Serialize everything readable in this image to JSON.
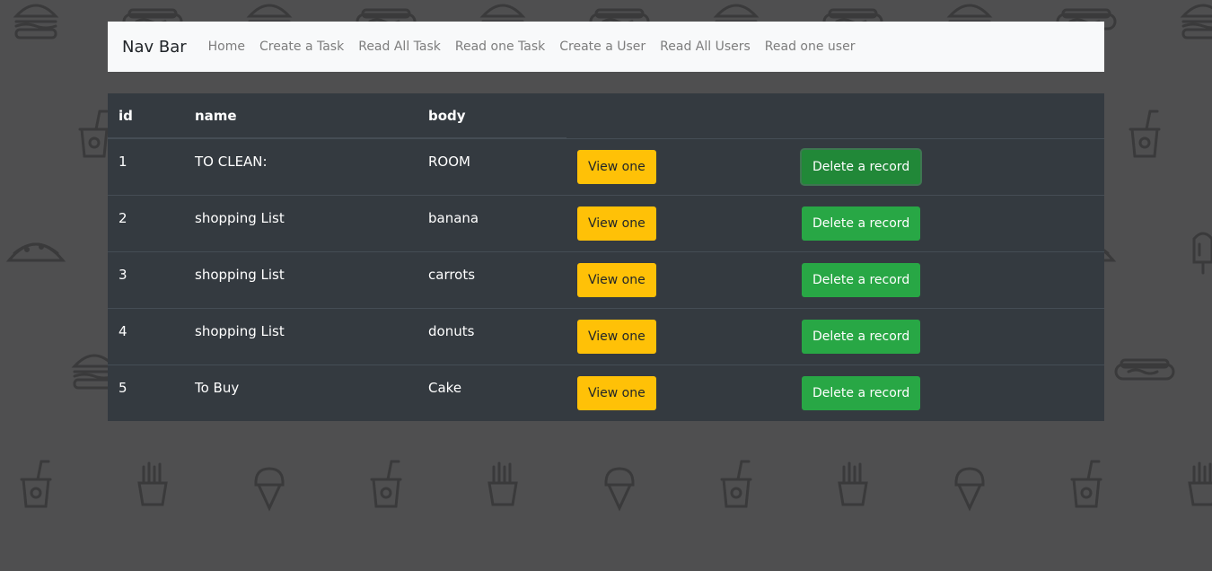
{
  "navbar": {
    "brand": "Nav Bar",
    "links": [
      "Home",
      "Create a Task",
      "Read All Task",
      "Read one Task",
      "Create a User",
      "Read All Users",
      "Read one user"
    ]
  },
  "table": {
    "headers": [
      "id",
      "name",
      "body"
    ],
    "rows": [
      {
        "id": "1",
        "name": "TO CLEAN:",
        "body": "ROOM"
      },
      {
        "id": "2",
        "name": "shopping List",
        "body": "banana"
      },
      {
        "id": "3",
        "name": "shopping List",
        "body": "carrots"
      },
      {
        "id": "4",
        "name": "shopping List",
        "body": "donuts"
      },
      {
        "id": "5",
        "name": "To Buy",
        "body": "Cake"
      }
    ],
    "view_label": "View one",
    "delete_label": "Delete a record"
  },
  "colors": {
    "page_background": "#4f4f50",
    "navbar_background": "#f8f9fa",
    "table_background": "#343a40",
    "view_button": "#ffc107",
    "delete_button": "#28a745"
  },
  "background_icons": [
    "burger-icon",
    "hotdog-icon",
    "soda-cup-icon",
    "fries-icon",
    "ice-cream-icon",
    "popsicle-icon",
    "taco-icon",
    "donut-icon"
  ]
}
